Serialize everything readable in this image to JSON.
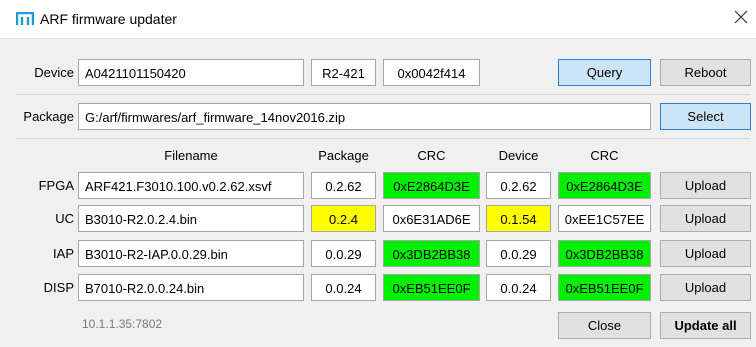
{
  "window": {
    "title": "ARF firmware updater"
  },
  "device": {
    "label": "Device",
    "serial": "A0421101150420",
    "revision": "R2-421",
    "id": "0x0042f414"
  },
  "package": {
    "label": "Package",
    "path": "G:/arf/firmwares/arf_firmware_14nov2016.zip"
  },
  "buttons": {
    "query": "Query",
    "reboot": "Reboot",
    "select": "Select",
    "close": "Close",
    "update_all": "Update all"
  },
  "columns": {
    "filename": "Filename",
    "package": "Package",
    "crc1": "CRC",
    "device": "Device",
    "crc2": "CRC"
  },
  "rows": [
    {
      "label": "FPGA",
      "filename": "ARF421.F3010.100.v0.2.62.xsvf",
      "package_ver": "0.2.62",
      "package_crc": "0xE2864D3E",
      "device_ver": "0.2.62",
      "device_crc": "0xE2864D3E",
      "upload": "Upload"
    },
    {
      "label": "UC",
      "filename": "B3010-R2.0.2.4.bin",
      "package_ver": "0.2.4",
      "package_crc": "0x6E31AD6E",
      "device_ver": "0.1.54",
      "device_crc": "0xEE1C57EE",
      "upload": "Upload"
    },
    {
      "label": "IAP",
      "filename": "B3010-R2-IAP.0.0.29.bin",
      "package_ver": "0.0.29",
      "package_crc": "0x3DB2BB38",
      "device_ver": "0.0.29",
      "device_crc": "0x3DB2BB38",
      "upload": "Upload"
    },
    {
      "label": "DISP",
      "filename": "B7010-R2.0.0.24.bin",
      "package_ver": "0.0.24",
      "package_crc": "0xEB51EE0F",
      "device_ver": "0.0.24",
      "device_crc": "0xEB51EE0F",
      "upload": "Upload"
    }
  ],
  "status": {
    "address": "10.1.1.35:7802"
  },
  "colors": {
    "match": "#00f000",
    "mismatch": "#ffff00",
    "accent": "#2f7fd0",
    "icon": "#1e9bd7"
  }
}
